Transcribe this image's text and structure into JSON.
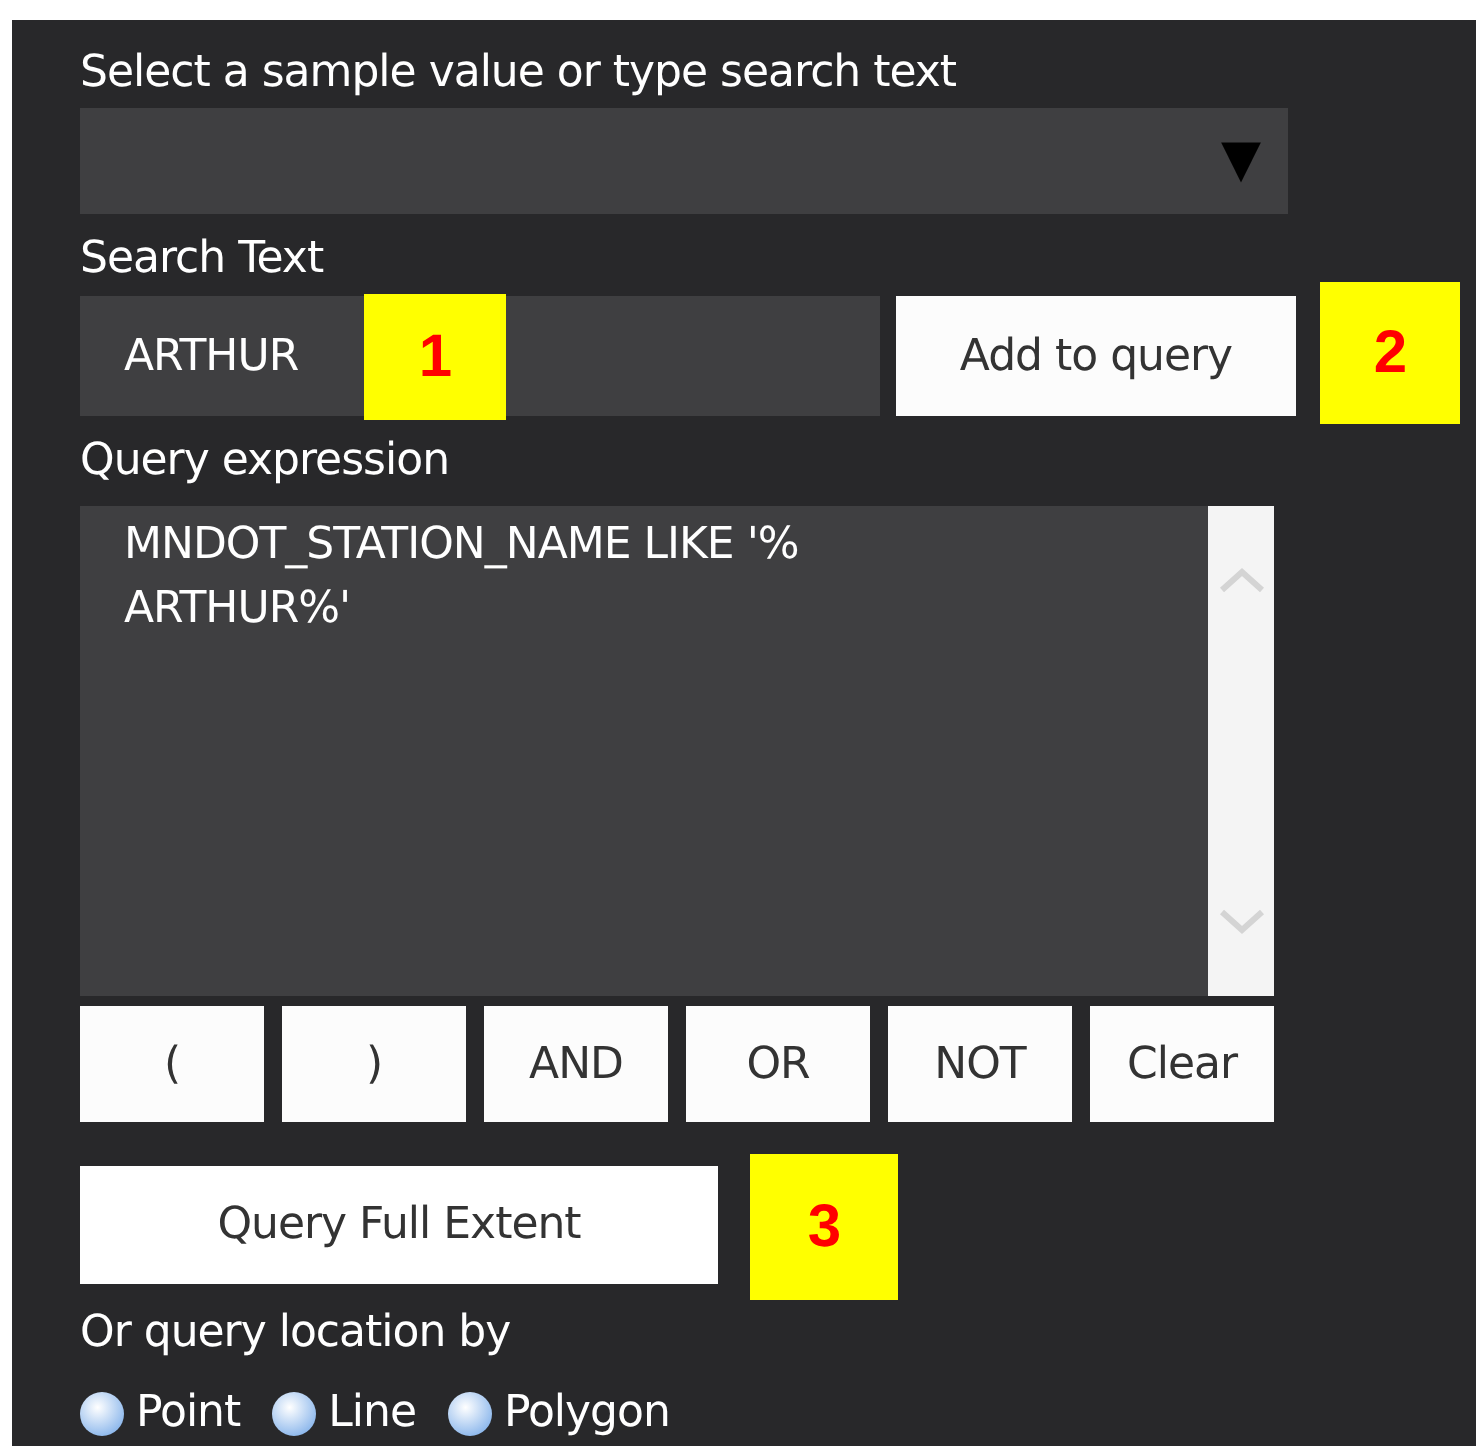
{
  "sample_value": {
    "label": "Select a sample value or type search text",
    "arrow": "▼"
  },
  "search_text": {
    "label": "Search Text",
    "value": "ARTHUR",
    "button": "Add to query"
  },
  "query_expression": {
    "label": "Query expression",
    "lines": [
      "MNDOT_STATION_NAME LIKE '%",
      "ARTHUR%'"
    ]
  },
  "operator_buttons": [
    "(",
    ")",
    "AND",
    "OR",
    "NOT",
    "Clear"
  ],
  "full_extent_button": "Query Full Extent",
  "location": {
    "label": "Or query location by",
    "options": [
      {
        "label": "Point",
        "selected": false
      },
      {
        "label": "Line",
        "selected": false
      },
      {
        "label": "Polygon",
        "selected": false
      }
    ]
  },
  "annotations": [
    "1",
    "2",
    "3"
  ]
}
